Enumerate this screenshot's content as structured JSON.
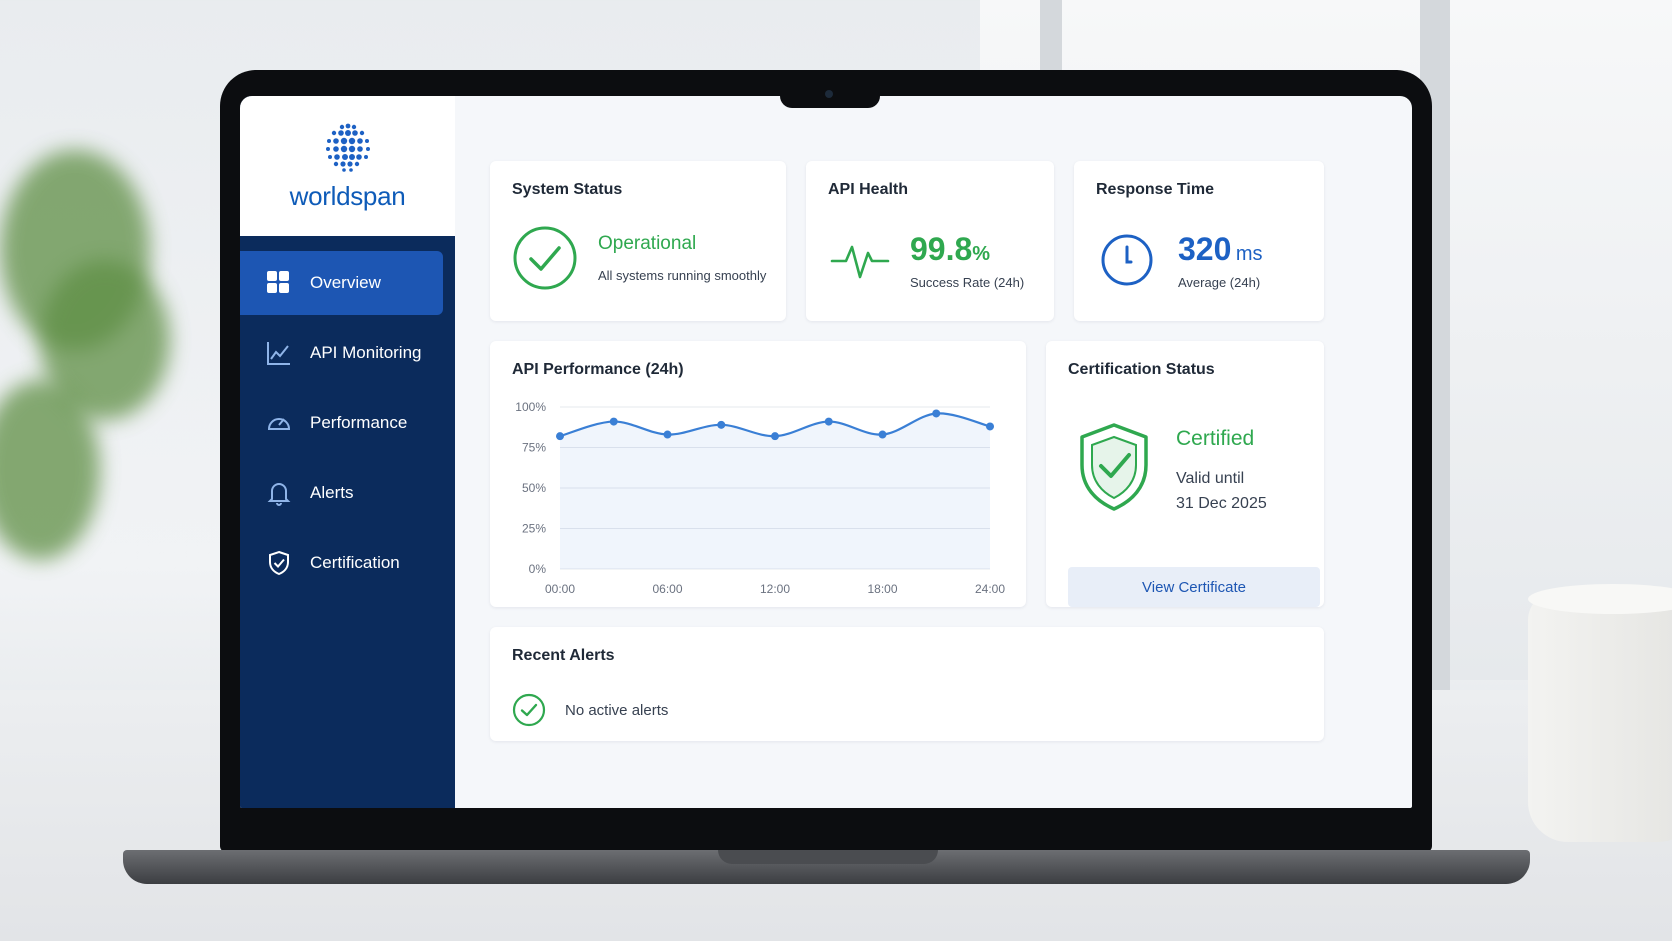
{
  "brand": {
    "name": "worldspan"
  },
  "sidebar": {
    "items": [
      {
        "label": "Overview",
        "icon": "grid-icon",
        "active": true
      },
      {
        "label": "API Monitoring",
        "icon": "line-chart-icon",
        "active": false
      },
      {
        "label": "Performance",
        "icon": "gauge-icon",
        "active": false
      },
      {
        "label": "Alerts",
        "icon": "bell-icon",
        "active": false
      },
      {
        "label": "Certification",
        "icon": "shield-check-icon",
        "active": false
      }
    ]
  },
  "system_status": {
    "title": "System Status",
    "status": "Operational",
    "detail": "All systems running smoothly"
  },
  "api_health": {
    "title": "API Health",
    "value": "99.8",
    "unit": "%",
    "label": "Success Rate (24h)"
  },
  "response_time": {
    "title": "Response Time",
    "value": "320",
    "unit": "ms",
    "label": "Average (24h)"
  },
  "performance": {
    "title": "API Performance (24h)"
  },
  "certification": {
    "title": "Certification Status",
    "status": "Certified",
    "valid_line1": "Valid until",
    "valid_line2": "31 Dec 2025",
    "button_label": "View Certificate"
  },
  "alerts": {
    "title": "Recent Alerts",
    "message": "No active alerts"
  },
  "colors": {
    "sidebar_bg": "#0b2b5c",
    "active_nav": "#1d56b3",
    "success_green": "#2fa84f",
    "accent_blue": "#1d61c4",
    "line_blue": "#3a7fd5"
  },
  "chart_data": {
    "type": "area",
    "title": "API Performance (24h)",
    "xlabel": "",
    "ylabel": "",
    "x_ticks": [
      "00:00",
      "06:00",
      "12:00",
      "18:00",
      "24:00"
    ],
    "y_ticks": [
      "100%",
      "75%",
      "50%",
      "25%",
      "0%"
    ],
    "ylim": [
      0,
      100
    ],
    "xlim": [
      0,
      24
    ],
    "grid": true,
    "series": [
      {
        "x": [
          0,
          3,
          6,
          9,
          12,
          15,
          18,
          21,
          24
        ],
        "values": [
          82,
          91,
          83,
          89,
          82,
          91,
          83,
          96,
          88
        ]
      }
    ]
  }
}
